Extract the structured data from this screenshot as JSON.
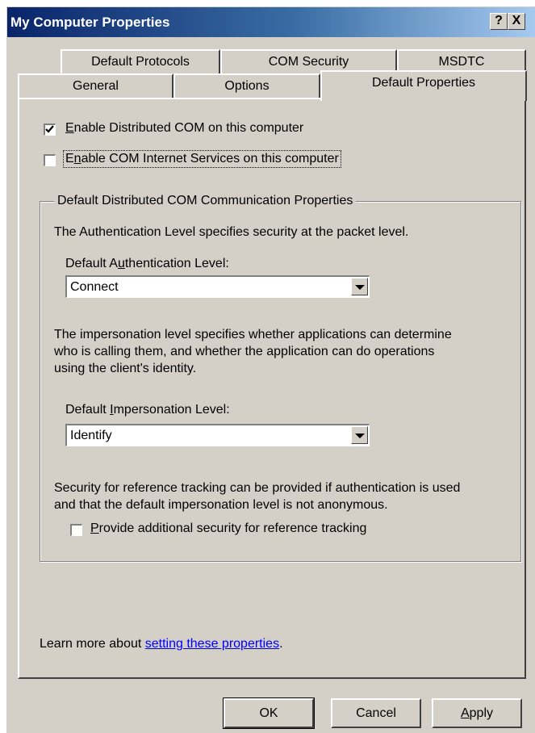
{
  "window": {
    "title": "My Computer Properties",
    "help_glyph": "?",
    "close_glyph": "X"
  },
  "tabs": {
    "row1": [
      "Default Protocols",
      "COM Security",
      "MSDTC"
    ],
    "row2": [
      "General",
      "Options",
      "Default Properties"
    ],
    "selected": "Default Properties"
  },
  "options": {
    "enable_dcom": {
      "pre": "",
      "mnemonic": "E",
      "post": "nable Distributed COM on this computer",
      "checked": true
    },
    "enable_cis": {
      "pre": "E",
      "mnemonic": "n",
      "post": "able COM Internet Services on this computer",
      "checked": false
    }
  },
  "group": {
    "title": "Default Distributed COM Communication Properties",
    "auth_desc": "The Authentication Level specifies security at the packet level.",
    "auth_label": {
      "pre": "Default A",
      "mnemonic": "u",
      "post": "thentication Level:"
    },
    "auth_value": "Connect",
    "imp_desc_1": "The impersonation level specifies whether applications can determine",
    "imp_desc_2": "who is calling them, and whether the application can do operations",
    "imp_desc_3": "using the client's identity.",
    "imp_label": {
      "pre": "Default ",
      "mnemonic": "I",
      "post": "mpersonation Level:"
    },
    "imp_value": "Identify",
    "ref_desc_1": "Security for reference tracking can be provided if authentication is used",
    "ref_desc_2": "and that the default impersonation level is not anonymous.",
    "ref_check": {
      "pre": "",
      "mnemonic": "P",
      "post": "rovide additional security for reference tracking",
      "checked": false
    }
  },
  "footer": {
    "learn_prefix": "Learn more about ",
    "learn_link": "setting these properties",
    "learn_suffix": "."
  },
  "buttons": {
    "ok": "OK",
    "cancel": "Cancel",
    "apply_mnemonic": "A",
    "apply_rest": "pply"
  },
  "colors": {
    "face": "#d4d0c8",
    "title_start": "#0a246a",
    "title_end": "#a6caf0",
    "link": "#0000ff"
  }
}
